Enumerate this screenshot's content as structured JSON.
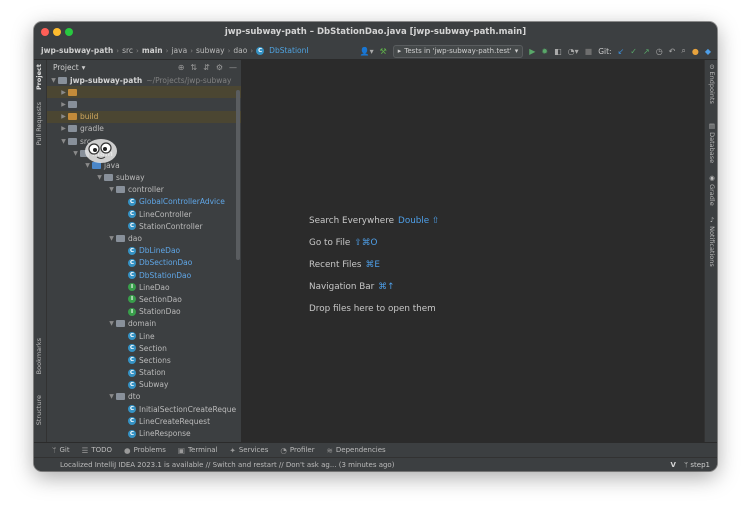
{
  "window": {
    "title": "jwp-subway-path – DbStationDao.java [jwp-subway-path.main]"
  },
  "navbar": {
    "crumbs": [
      "jwp-subway-path",
      "src",
      "main",
      "java",
      "subway",
      "dao"
    ],
    "file": "DbStationI",
    "run_config": "Tests in 'jwp-subway-path.test'",
    "git_label": "Git:"
  },
  "left_tabs": {
    "project": "Project",
    "pull_requests": "Pull Requests",
    "bookmarks": "Bookmarks",
    "structure": "Structure"
  },
  "right_tabs": {
    "endpoints": "Endpoints",
    "database": "Database",
    "gradle": "Gradle",
    "notifications": "Notifications"
  },
  "project_panel": {
    "header": "Project",
    "root": {
      "name": "jwp-subway-path",
      "path": "~/Projects/jwp-subway"
    },
    "build": "build",
    "gradle": "gradle",
    "src": "src",
    "main": "main",
    "java": "java",
    "subway": "subway",
    "controller": {
      "name": "controller",
      "files": [
        "GlobalControllerAdvice",
        "LineController",
        "StationController"
      ]
    },
    "dao": {
      "name": "dao",
      "files_blue": [
        "DbLineDao",
        "DbSectionDao",
        "DbStationDao"
      ],
      "files_green": [
        "LineDao",
        "SectionDao",
        "StationDao"
      ]
    },
    "domain": {
      "name": "domain",
      "files": [
        "Line",
        "Section",
        "Sections",
        "Station",
        "Subway"
      ]
    },
    "dto": {
      "name": "dto",
      "files": [
        "InitialSectionCreateReque",
        "LineCreateRequest",
        "LineResponse"
      ]
    }
  },
  "editor_hints": [
    {
      "label": "Search Everywhere",
      "key": "Double ⇧"
    },
    {
      "label": "Go to File",
      "key": "⇧⌘O"
    },
    {
      "label": "Recent Files",
      "key": "⌘E"
    },
    {
      "label": "Navigation Bar",
      "key": "⌘↑"
    },
    {
      "label": "Drop files here to open them",
      "key": ""
    }
  ],
  "tool_windows": [
    "Git",
    "TODO",
    "Problems",
    "Terminal",
    "Services",
    "Profiler",
    "Dependencies"
  ],
  "status": {
    "message": "Localized IntelliJ IDEA 2023.1 is available // Switch and restart // Don't ask ag... (3 minutes ago)",
    "branch": "step1"
  }
}
